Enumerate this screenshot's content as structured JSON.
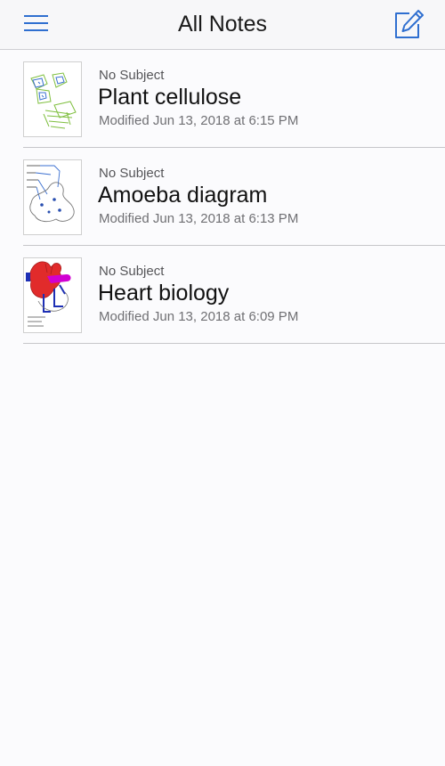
{
  "header": {
    "title": "All Notes",
    "menu_icon": "hamburger-menu-icon",
    "compose_icon": "compose-pencil-icon"
  },
  "colors": {
    "accent": "#2f6fd0",
    "navbar_bg": "#f7f7f9",
    "page_bg": "#fbfbfd",
    "separator": "#c6c6ca"
  },
  "notes": [
    {
      "subject": "No Subject",
      "title": "Plant cellulose",
      "modified": "Modified Jun 13, 2018 at 6:15 PM",
      "thumbnail": "plant-cell-sketch"
    },
    {
      "subject": "No Subject",
      "title": "Amoeba diagram",
      "modified": "Modified Jun 13, 2018 at 6:13 PM",
      "thumbnail": "amoeba-sketch"
    },
    {
      "subject": "No Subject",
      "title": "Heart biology",
      "modified": "Modified Jun 13, 2018 at 6:09 PM",
      "thumbnail": "heart-sketch"
    }
  ]
}
